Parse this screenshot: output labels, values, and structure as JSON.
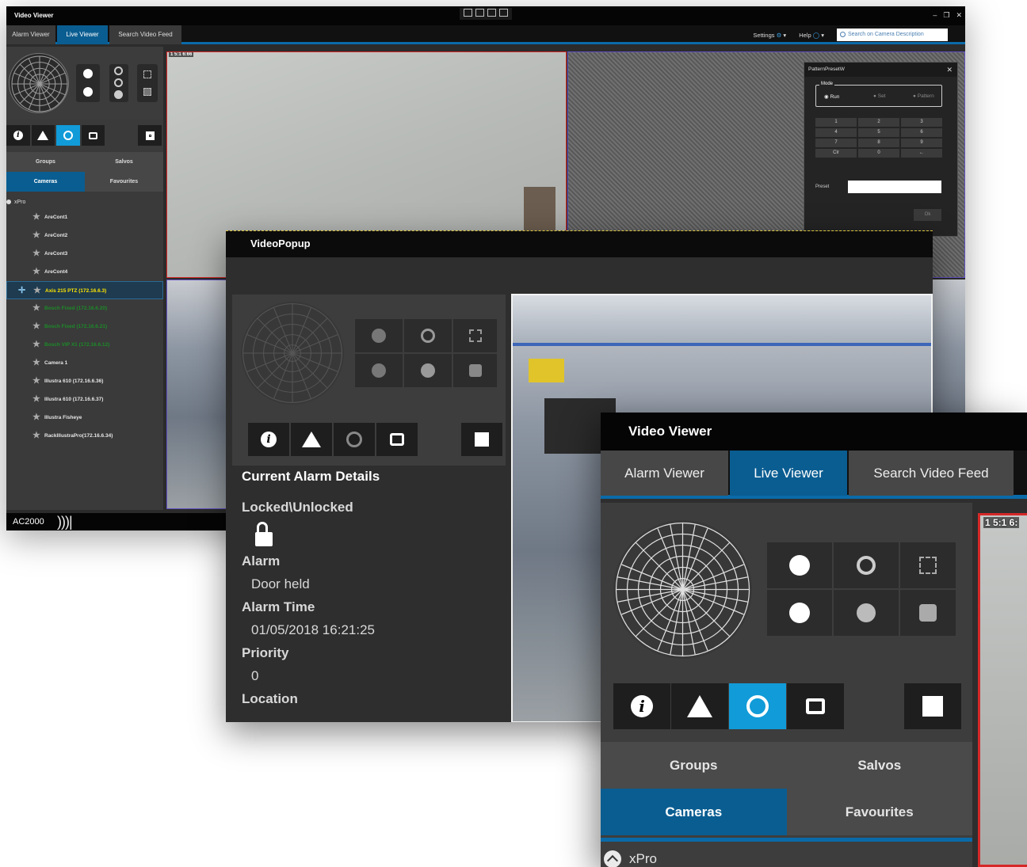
{
  "main_window": {
    "title": "Video Viewer",
    "tabs": [
      "Alarm Viewer",
      "Live Viewer",
      "Search Video Feed"
    ],
    "active_tab": "Live Viewer",
    "settings_label": "Settings",
    "help_label": "Help",
    "search_placeholder": "Search on Camera Description",
    "groups_label": "Groups",
    "salvos_label": "Salvos",
    "cameras_label": "Cameras",
    "favourites_label": "Favourites",
    "tree_root": "xPro",
    "cameras": [
      {
        "name": "AreCont1",
        "state": "normal"
      },
      {
        "name": "AreCont2",
        "state": "normal"
      },
      {
        "name": "AreCont3",
        "state": "normal"
      },
      {
        "name": "AreCont4",
        "state": "normal"
      },
      {
        "name": "Axis 215 PTZ (172.16.6.3)",
        "state": "selected"
      },
      {
        "name": "Bosch Fixed (172.16.6.20)",
        "state": "green"
      },
      {
        "name": "Bosch Fixed (172.16.6.21)",
        "state": "green"
      },
      {
        "name": "Bosch VIP X1 (172.16.6.12)",
        "state": "green"
      },
      {
        "name": "Camera 1",
        "state": "normal"
      },
      {
        "name": "Illustra 610 (172.16.6.36)",
        "state": "normal"
      },
      {
        "name": "Illustra 610 (172.16.6.37)",
        "state": "normal"
      },
      {
        "name": "Illustra Fisheye",
        "state": "normal"
      },
      {
        "name": "RackIllustraPro(172.16.6.34)",
        "state": "normal"
      }
    ],
    "status_brand": "AC2000",
    "video_timestamp": "1 5:1 6:66",
    "pattern_dialog": {
      "title": "PatternPresetW",
      "mode_label": "Mode",
      "modes": [
        "Run",
        "Set",
        "Pattern"
      ],
      "active_mode": "Run",
      "keypad": [
        "1",
        "2",
        "3",
        "4",
        "5",
        "6",
        "7",
        "8",
        "9",
        "Clr",
        "0",
        "←"
      ],
      "preset_label": "Preset",
      "ok_label": "Ok"
    }
  },
  "video_popup": {
    "title": "VideoPopup",
    "section_title": "Current Alarm Details",
    "lock_label": "Locked\\Unlocked",
    "alarm_label": "Alarm",
    "alarm_value": "Door held",
    "alarm_time_label": "Alarm Time",
    "alarm_time_value": "01/05/2018 16:21:25",
    "priority_label": "Priority",
    "priority_value": "0",
    "location_label": "Location"
  },
  "front_panel": {
    "title": "Video Viewer",
    "tabs": [
      "Alarm Viewer",
      "Live Viewer",
      "Search Video Feed"
    ],
    "active_tab": "Live Viewer",
    "groups_label": "Groups",
    "salvos_label": "Salvos",
    "cameras_label": "Cameras",
    "favourites_label": "Favourites",
    "tree_root": "xPro",
    "video_timestamp": "1 5:1 6:"
  },
  "colors": {
    "accent_blue": "#0a5d91",
    "active_icon_blue": "#119bd8",
    "selected_camera_text": "#ffe600",
    "offline_camera_text": "#1d8a29",
    "video_border_red": "#d52828"
  }
}
